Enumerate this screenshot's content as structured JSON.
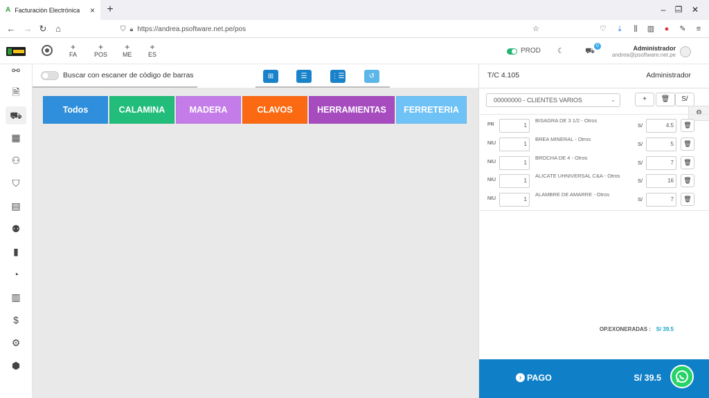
{
  "browser": {
    "tab_title": "Facturación Electrónica",
    "url": "https://andrea.psoftware.net.pe/pos",
    "window_controls": [
      "–",
      "❐",
      "✕"
    ]
  },
  "header": {
    "links": [
      {
        "label": "FA"
      },
      {
        "label": "POS"
      },
      {
        "label": "ME"
      },
      {
        "label": "ES"
      }
    ],
    "mode": "PROD",
    "cart_count": "0",
    "user_name": "Administrador",
    "user_email": "andrea@psoftware.net.pe"
  },
  "sidebar": {
    "items": [
      {
        "icon": "wand-icon"
      },
      {
        "icon": "document-icon"
      },
      {
        "icon": "cart-icon",
        "active": true
      },
      {
        "icon": "grid-icon"
      },
      {
        "icon": "user-check-icon"
      },
      {
        "icon": "bag-icon"
      },
      {
        "icon": "archive-icon"
      },
      {
        "icon": "users-icon"
      },
      {
        "icon": "receipt-icon"
      },
      {
        "icon": "pie-chart-icon"
      },
      {
        "icon": "bar-chart-icon"
      },
      {
        "icon": "dollar-icon"
      },
      {
        "icon": "settings-icon"
      },
      {
        "icon": "box-icon"
      }
    ]
  },
  "toolbar": {
    "scan_label": "Buscar con escaner de código de barras"
  },
  "categories": [
    {
      "label": "Todos",
      "color": "#2f8fdc"
    },
    {
      "label": "CALAMINA",
      "color": "#22bd7a"
    },
    {
      "label": "MADERA",
      "color": "#c47de8"
    },
    {
      "label": "CLAVOS",
      "color": "#fb6a12"
    },
    {
      "label": "HERRAMIENTAS",
      "color": "#a64cbf"
    },
    {
      "label": "FERRETERIA",
      "color": "#6ec2f5"
    }
  ],
  "right": {
    "exchange_rate": "T/C 4.105",
    "admin_label": "Administrador",
    "client": "00000000 - CLIENTES VARIOS",
    "currency_btn": "S/",
    "items": [
      {
        "unit": "PR",
        "qty": "1",
        "name": "BISAGRA DE 3 1/2 - Otros",
        "currency": "S/",
        "price": "4.5"
      },
      {
        "unit": "NIU",
        "qty": "1",
        "name": "BREA MINERAL - Otros",
        "currency": "S/",
        "price": "5"
      },
      {
        "unit": "NIU",
        "qty": "1",
        "name": "BROCHA DE 4 - Otros",
        "currency": "S/",
        "price": "7"
      },
      {
        "unit": "NIU",
        "qty": "1",
        "name": "ALICATE UHNIVERSAL C&A - Otros",
        "currency": "S/",
        "price": "16"
      },
      {
        "unit": "NIU",
        "qty": "1",
        "name": "ALAMBRE DE AMARRE - Otros",
        "currency": "S/",
        "price": "7"
      }
    ],
    "op_label": "OP.EXONERADAS :",
    "op_value": "S/ 39.5",
    "pay_label": "PAGO",
    "pay_total": "S/ 39.5"
  }
}
